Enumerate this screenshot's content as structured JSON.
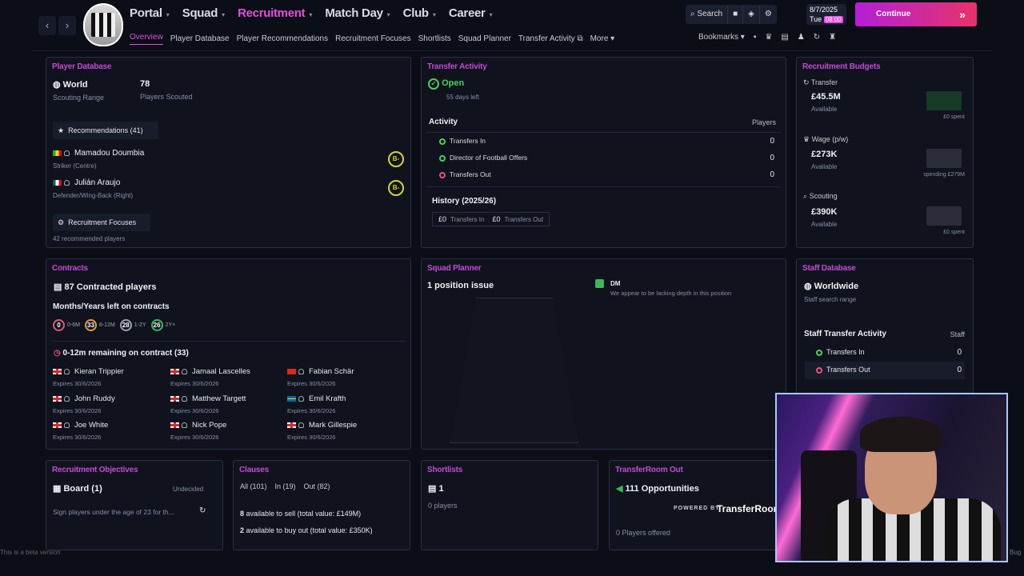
{
  "nav": {
    "back": "‹",
    "forward": "›",
    "items": [
      {
        "label": "Portal"
      },
      {
        "label": "Squad"
      },
      {
        "label": "Recruitment"
      },
      {
        "label": "Match Day"
      },
      {
        "label": "Club"
      },
      {
        "label": "Career"
      }
    ],
    "sub": [
      "Overview",
      "Player Database",
      "Player Recommendations",
      "Recruitment Focuses",
      "Shortlists",
      "Squad Planner",
      "Transfer Activity",
      "More"
    ]
  },
  "toolbar": {
    "search": "Search",
    "date": "8/7/2025",
    "day": "Tue",
    "time": "08:00",
    "continue": "Continue",
    "bookmarks": "Bookmarks"
  },
  "player_db": {
    "title": "Player Database",
    "range_value": "World",
    "range_label": "Scouting Range",
    "count": "78",
    "count_label": "Players Scouted",
    "recs": "Recommendations (41)",
    "players": [
      {
        "name": "Mamadou Doumbia",
        "pos": "Striker (Centre)",
        "grade": "B-"
      },
      {
        "name": "Julián Araujo",
        "pos": "Defender/Wing-Back (Right)",
        "grade": "B-"
      }
    ],
    "focus": "Recruitment Focuses",
    "focus_sub": "42 recommended players"
  },
  "transfer": {
    "title": "Transfer Activity",
    "status": "Open",
    "days": "55 days left",
    "activity": "Activity",
    "players_col": "Players",
    "rows": [
      {
        "label": "Transfers In",
        "value": "0"
      },
      {
        "label": "Director of Football Offers",
        "value": "0"
      },
      {
        "label": "Transfers Out",
        "value": "0"
      }
    ],
    "history": "History (2025/26)",
    "in_amt": "£0",
    "in_lbl": "Transfers In",
    "out_amt": "£0",
    "out_lbl": "Transfers Out"
  },
  "budgets": {
    "title": "Recruitment Budgets",
    "items": [
      {
        "label": "Transfer",
        "value": "£45.5M",
        "sub": "Available",
        "note": "£0 spent"
      },
      {
        "label": "Wage (p/w)",
        "value": "£273K",
        "sub": "Available",
        "note": "spending £279M"
      },
      {
        "label": "Scouting",
        "value": "£390K",
        "sub": "Available",
        "note": "£0 spent"
      }
    ]
  },
  "contracts": {
    "title": "Contracts",
    "count": "87 Contracted players",
    "months": "Months/Years left on contracts",
    "bands": [
      {
        "n": "0",
        "l": "0-6M",
        "c": "#e2557a"
      },
      {
        "n": "33",
        "l": "6-12M",
        "c": "#e39a3b"
      },
      {
        "n": "28",
        "l": "1-2Y",
        "c": "#9aa0b4"
      },
      {
        "n": "26",
        "l": "2Y+",
        "c": "#41b55a"
      }
    ],
    "remaining": "0-12m remaining on contract (33)",
    "players": [
      {
        "name": "Kieran Trippier",
        "exp": "Expires 30/6/2026",
        "flag": "eng"
      },
      {
        "name": "Jamaal Lascelles",
        "exp": "Expires 30/6/2026",
        "flag": "eng"
      },
      {
        "name": "Fabian Schär",
        "exp": "Expires 30/6/2026",
        "flag": "swi"
      },
      {
        "name": "John Ruddy",
        "exp": "Expires 30/6/2026",
        "flag": "eng"
      },
      {
        "name": "Matthew Targett",
        "exp": "Expires 30/6/2026",
        "flag": "eng"
      },
      {
        "name": "Emil Krafth",
        "exp": "Expires 30/6/2026",
        "flag": "swe"
      },
      {
        "name": "Joe White",
        "exp": "Expires 30/6/2026",
        "flag": "eng"
      },
      {
        "name": "Nick Pope",
        "exp": "Expires 30/6/2026",
        "flag": "eng"
      },
      {
        "name": "Mark Gillespie",
        "exp": "Expires 30/6/2026",
        "flag": "eng"
      }
    ]
  },
  "squad": {
    "title": "Squad Planner",
    "issue": "1 position issue",
    "pos": "DM",
    "note": "We appear to be lacking depth in this position"
  },
  "staff": {
    "title": "Staff Database",
    "range": "Worldwide",
    "range_sub": "Staff search range",
    "activity": "Staff Transfer Activity",
    "col": "Staff",
    "rows": [
      {
        "label": "Transfers In",
        "value": "0"
      },
      {
        "label": "Transfers Out",
        "value": "0"
      }
    ]
  },
  "objectives": {
    "title": "Recruitment Objectives",
    "board": "Board (1)",
    "status": "Undecided",
    "text": "Sign players under the age of 23 for th..."
  },
  "clauses": {
    "title": "Clauses",
    "all": "All (101)",
    "in": "In (19)",
    "out": "Out (82)",
    "sell": "available to sell (total value: £149M)",
    "sell_n": "8",
    "buy": "available to buy out (total value: £350K)",
    "buy_n": "2"
  },
  "shortlists": {
    "title": "Shortlists",
    "count": "1",
    "sub": "0 players"
  },
  "transferroom": {
    "title": "TransferRoom Out",
    "opps": "111 Opportunities",
    "powered": "POWERED BY",
    "brand": "TransferRoom",
    "offered": "0 Players offered"
  },
  "footer": {
    "beta": "This is a beta version",
    "bug": "Bug"
  },
  "colors": {
    "accent": "#e44ee0",
    "title": "#c44ad6",
    "continue_start": "#b31fd6",
    "continue_end": "#e8336a"
  }
}
